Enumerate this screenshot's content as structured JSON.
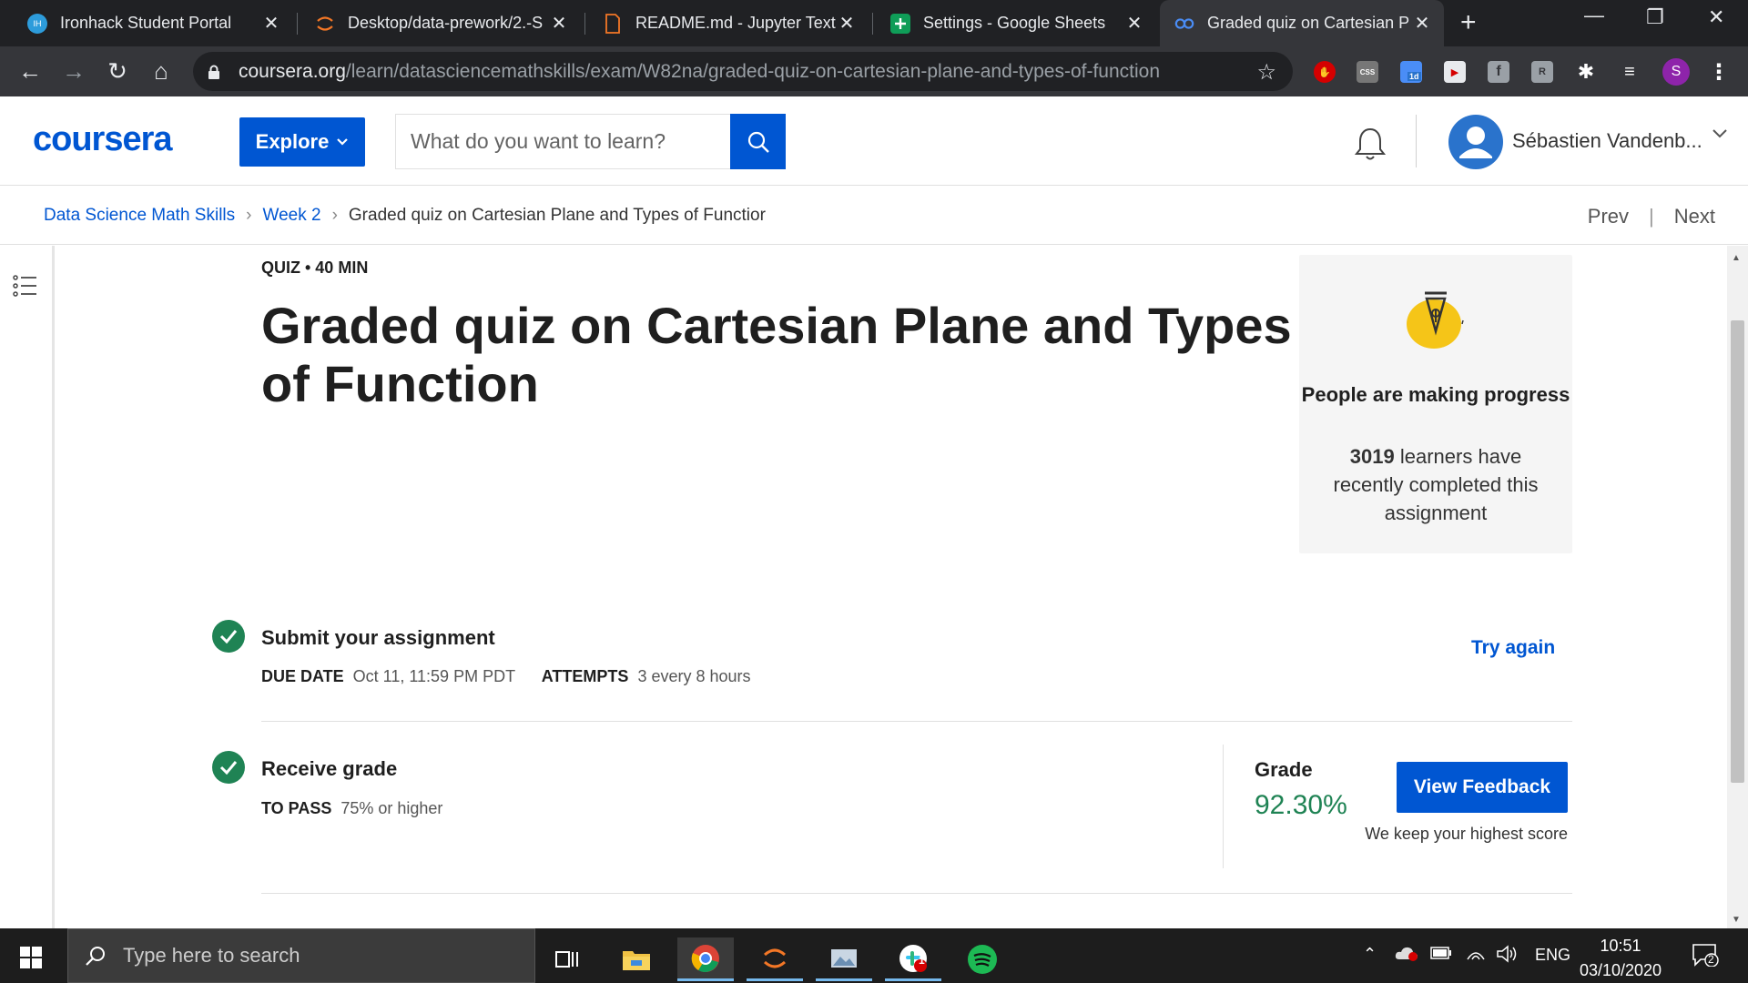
{
  "browser": {
    "tabs": [
      {
        "label": "Ironhack Student Portal",
        "icon": "ironhack-icon"
      },
      {
        "label": "Desktop/data-prework/2.-S",
        "icon": "jupyter-icon"
      },
      {
        "label": "README.md - Jupyter Text E",
        "icon": "file-icon"
      },
      {
        "label": "Settings - Google Sheets",
        "icon": "sheets-icon"
      },
      {
        "label": "Graded quiz on Cartesian P",
        "icon": "coursera-icon"
      }
    ],
    "url_host": "coursera.org",
    "url_path": "/learn/datasciencemathskills/exam/W82na/graded-quiz-on-cartesian-plane-and-types-of-function",
    "extensions": [
      "adblock-icon",
      "css-icon",
      "calendar-icon",
      "media-icon",
      "facebook-icon",
      "ext-icon",
      "puzzle-icon",
      "playlist-icon"
    ],
    "calendar_badge": "1d",
    "profile_initial": "S"
  },
  "header": {
    "logo": "coursera",
    "explore_label": "Explore",
    "search_placeholder": "What do you want to learn?",
    "username": "Sébastien Vandenb..."
  },
  "breadcrumb": {
    "items": [
      "Data Science Math Skills",
      "Week 2",
      "Graded quiz on Cartesian Plane and Types of Functior"
    ],
    "prev": "Prev",
    "separator": "|",
    "next": "Next"
  },
  "quiz": {
    "meta": "QUIZ • 40 MIN",
    "title": "Graded quiz on Cartesian Plane and Types of Function"
  },
  "progress_card": {
    "title": "People are making progress",
    "count": "3019",
    "desc": "learners have recently completed this assignment"
  },
  "submit": {
    "title": "Submit your assignment",
    "due_label": "DUE DATE",
    "due_value": "Oct 11, 11:59 PM PDT",
    "attempts_label": "ATTEMPTS",
    "attempts_value": "3 every 8 hours",
    "try_again": "Try again"
  },
  "receive": {
    "title": "Receive grade",
    "pass_label": "TO PASS",
    "pass_value": "75% or higher",
    "grade_label": "Grade",
    "grade_value": "92.30%",
    "view_feedback": "View Feedback",
    "keep_highest": "We keep your highest score"
  },
  "taskbar": {
    "search_placeholder": "Type here to search",
    "apps": [
      "task-view-icon",
      "file-explorer-icon",
      "chrome-icon",
      "jupyter-icon",
      "photos-icon",
      "slack-icon",
      "spotify-icon"
    ],
    "slack_badge": "1",
    "language": "ENG",
    "time": "10:51",
    "date": "03/10/2020",
    "notification_count": "2"
  },
  "colors": {
    "brand": "#0056d2",
    "success": "#1f8354"
  }
}
